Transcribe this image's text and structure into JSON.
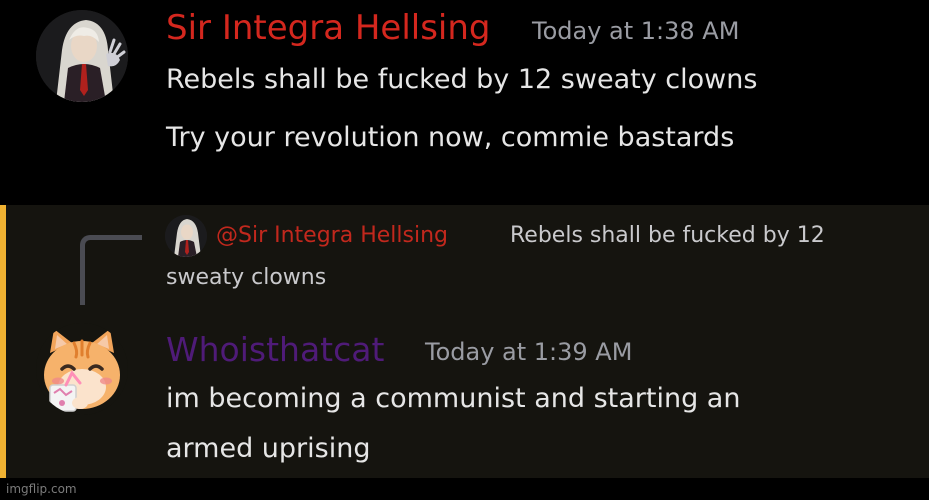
{
  "messages": [
    {
      "author": "Sir Integra Hellsing",
      "author_color": "#d4271e",
      "timestamp": "Today at 1:38 AM",
      "lines": [
        "Rebels shall be fucked by 12 sweaty clowns",
        "Try your revolution now, commie bastards"
      ]
    },
    {
      "highlight_color": "#f0b232",
      "reply": {
        "mention": "@Sir Integra Hellsing",
        "text_line1": "Rebels shall be fucked by 12",
        "text_line2": "sweaty clowns"
      },
      "author": "Whoisthatcat",
      "author_color": "#4f1b78",
      "timestamp": "Today at 1:39 AM",
      "lines": [
        "im becoming a communist and starting an",
        "armed uprising"
      ]
    }
  ],
  "watermark": "imgflip.com",
  "icons": {
    "avatar_1": "white-haired-figure-avatar",
    "avatar_2": "orange-cat-drinking-avatar"
  }
}
